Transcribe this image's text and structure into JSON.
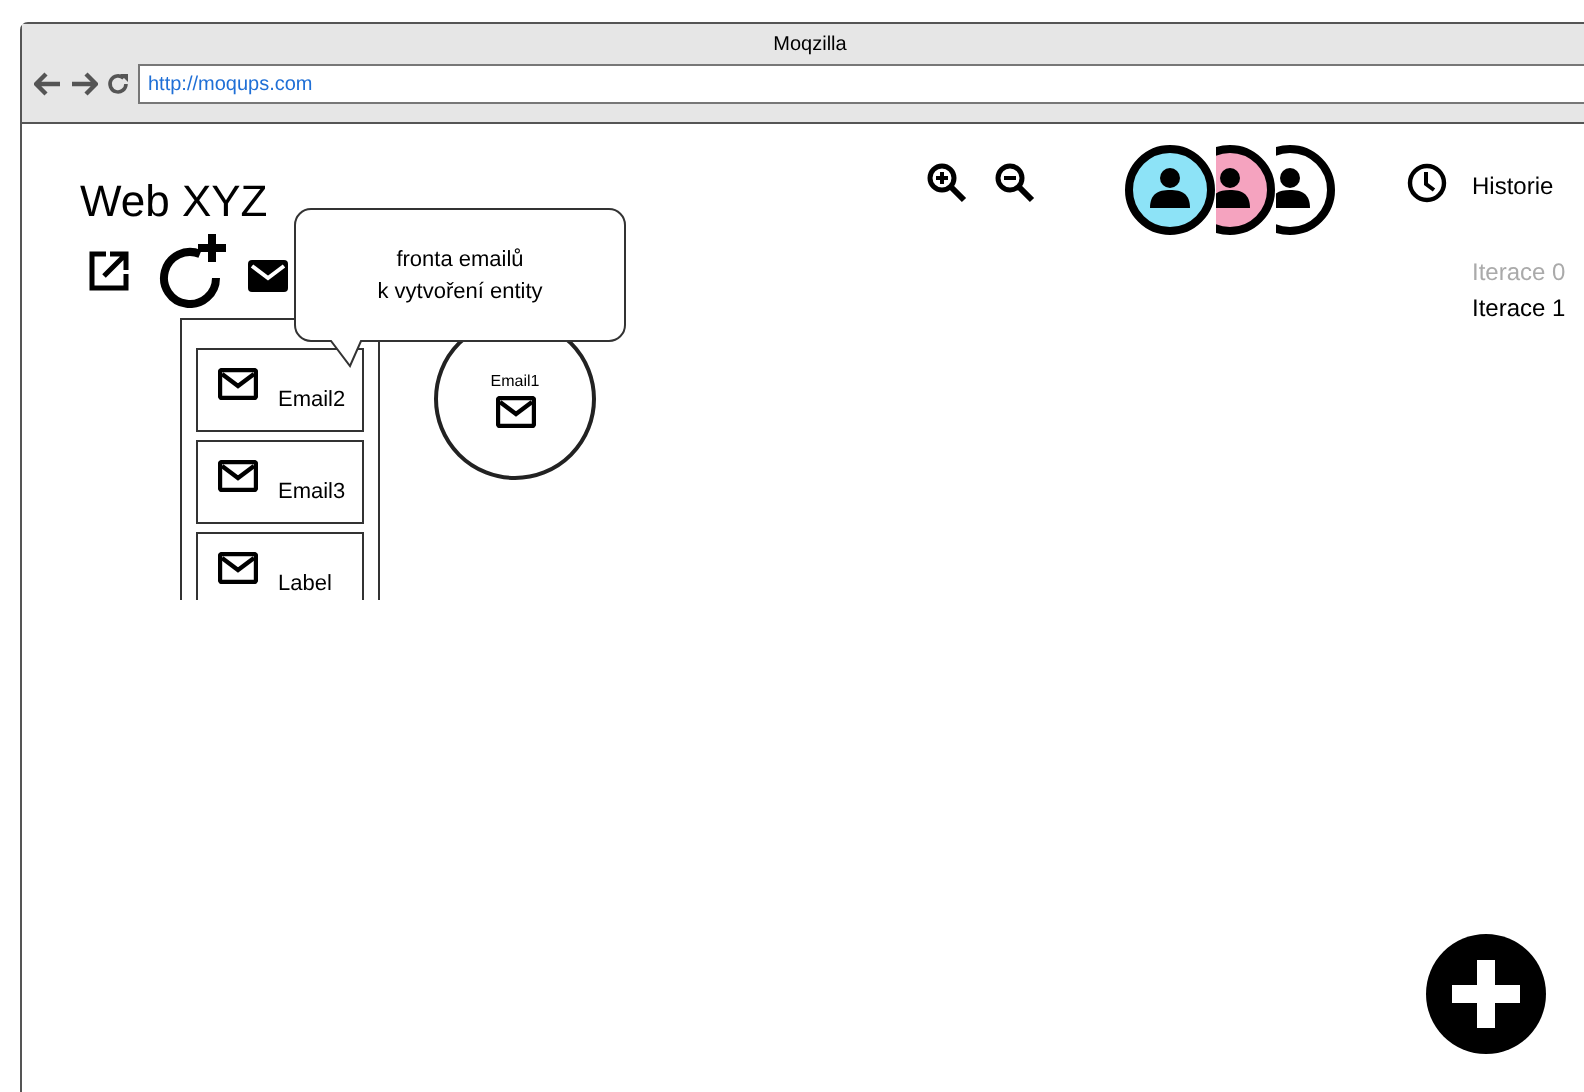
{
  "window": {
    "title": "Moqzilla",
    "url": "http://moqups.com"
  },
  "page": {
    "title": "Web XYZ",
    "tooltip": {
      "lines": [
        "fronta emailů",
        "k vytvoření entity"
      ]
    },
    "email_queue": [
      {
        "label": "Email2"
      },
      {
        "label": "Email3"
      },
      {
        "label": "Label"
      }
    ],
    "entity": {
      "label": "Email1"
    },
    "users": [
      {
        "color": "#8de3f7"
      },
      {
        "color": "#f5a3bf"
      },
      {
        "color": "#ffffff"
      }
    ],
    "history": {
      "label": "Historie"
    },
    "iterations": [
      {
        "label": "Iterace 0",
        "selected": false
      },
      {
        "label": "Iterace 1",
        "selected": true
      }
    ]
  }
}
